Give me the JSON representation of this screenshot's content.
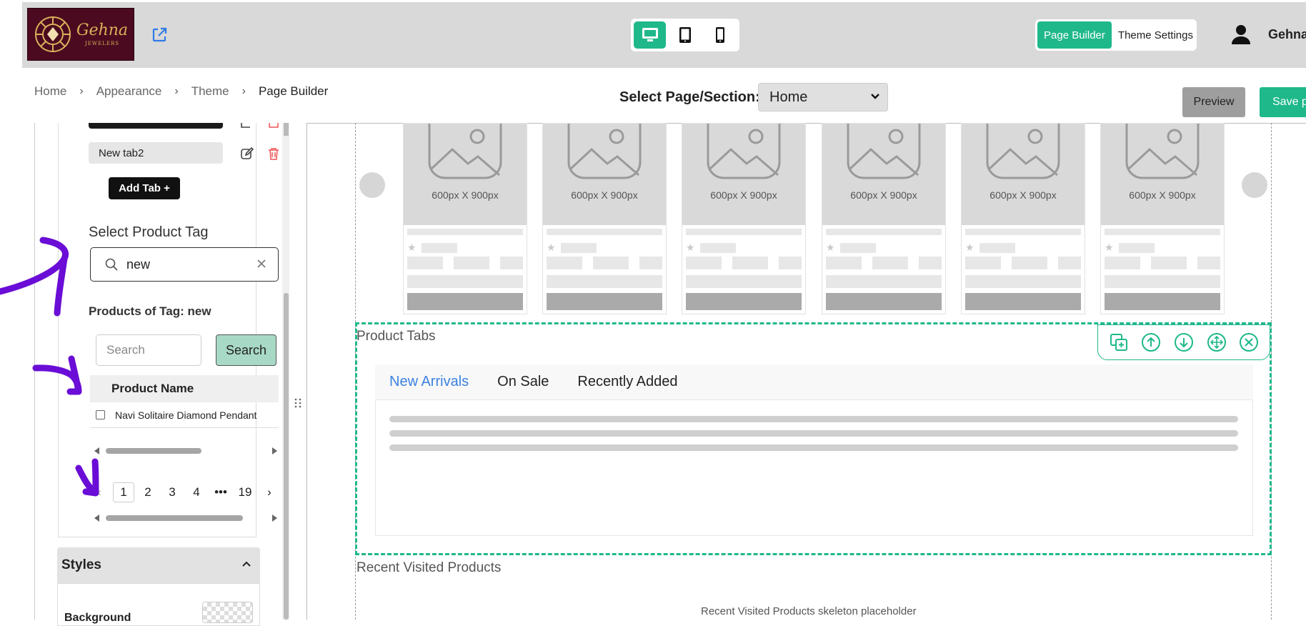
{
  "header": {
    "brand_name": "Gehna",
    "brand_sub": "JEWELERS",
    "mode_tabs": [
      "Page Builder",
      "Theme Settings"
    ],
    "active_mode": "Page Builder",
    "user_name": "Gehna",
    "devices": [
      "desktop-icon",
      "tablet-icon",
      "mobile-icon"
    ]
  },
  "breadcrumb": [
    "Home",
    "Appearance",
    "Theme",
    "Page Builder"
  ],
  "page_select": {
    "label": "Select Page/Section:",
    "value": "Home"
  },
  "actions": {
    "preview": "Preview",
    "save": "Save page"
  },
  "left_panel": {
    "tabs": [
      "New tab2"
    ],
    "add_tab": "Add Tab +",
    "tag_label": "Select Product Tag",
    "tag_value": "new",
    "products_of_tag": "Products of Tag: new",
    "search_placeholder": "Search",
    "search_button": "Search",
    "table_header": "Product Name",
    "rows": [
      "Navi Solitaire Diamond Pendant"
    ],
    "pages": [
      "1",
      "2",
      "3",
      "4",
      "•••",
      "19"
    ],
    "current_page": "1",
    "styles_title": "Styles",
    "background_label": "Background"
  },
  "canvas": {
    "card_dims": "600px X 900px",
    "product_tabs_title": "Product Tabs",
    "product_tabs": [
      "New Arrivals",
      "On Sale",
      "Recently Added"
    ],
    "active_product_tab": "New Arrivals",
    "recent_title": "Recent Visited Products",
    "recent_placeholder": "Recent Visited Products skeleton placeholder",
    "tool_icons": [
      "duplicate-icon",
      "move-up-icon",
      "move-down-icon",
      "drag-move-icon",
      "close-icon"
    ]
  },
  "colors": {
    "accent": "#1fb88a",
    "annotation": "#6a0dd6",
    "link": "#3b82e0"
  }
}
